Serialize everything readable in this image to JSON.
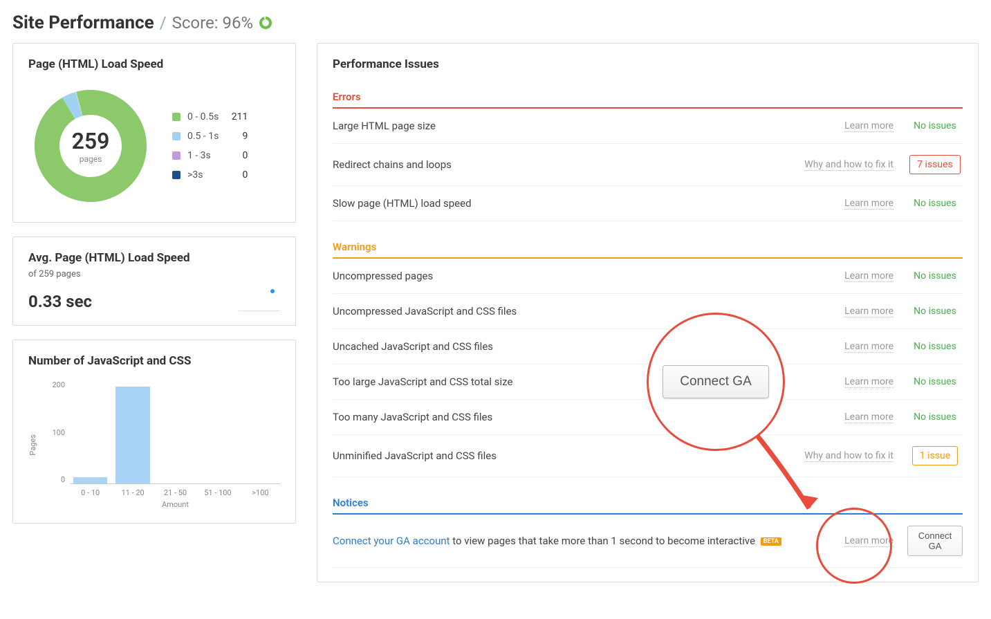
{
  "header": {
    "title": "Site Performance",
    "score_label": "Score: 96%",
    "score_ring_color": "#6bbf47"
  },
  "donut_card": {
    "title": "Page (HTML) Load Speed",
    "total": "259",
    "total_label": "pages",
    "legend": [
      {
        "label": "0 - 0.5s",
        "value": "211",
        "color": "#8bc96a"
      },
      {
        "label": "0.5 - 1s",
        "value": "9",
        "color": "#a2d2f2"
      },
      {
        "label": "1 - 3s",
        "value": "0",
        "color": "#c49bd8"
      },
      {
        "label": ">3s",
        "value": "0",
        "color": "#1a4f8b"
      }
    ]
  },
  "avg_card": {
    "title": "Avg. Page (HTML) Load Speed",
    "subtitle": "of 259 pages",
    "value": "0.33 sec"
  },
  "bar_card": {
    "title": "Number of JavaScript and CSS",
    "y_ticks": [
      "200",
      "100",
      "0"
    ],
    "y_label": "Pages",
    "x_label": "Amount",
    "bars": [
      {
        "label": "0 - 10",
        "h": 6
      },
      {
        "label": "11 - 20",
        "h": 94
      },
      {
        "label": "21 - 50",
        "h": 0
      },
      {
        "label": "51 - 100",
        "h": 0
      },
      {
        "label": ">100",
        "h": 0
      }
    ]
  },
  "issues": {
    "title": "Performance Issues",
    "errors": {
      "heading": "Errors",
      "rows": [
        {
          "name": "Large HTML page size",
          "hint": "Learn more",
          "status": "No issues",
          "kind": "ok"
        },
        {
          "name": "Redirect chains and loops",
          "hint": "Why and how to fix it",
          "status": "7 issues",
          "kind": "err"
        },
        {
          "name": "Slow page (HTML) load speed",
          "hint": "Learn more",
          "status": "No issues",
          "kind": "ok"
        }
      ]
    },
    "warnings": {
      "heading": "Warnings",
      "rows": [
        {
          "name": "Uncompressed pages",
          "hint": "Learn more",
          "status": "No issues",
          "kind": "ok"
        },
        {
          "name": "Uncompressed JavaScript and CSS files",
          "hint": "Learn more",
          "status": "No issues",
          "kind": "ok"
        },
        {
          "name": "Uncached JavaScript and CSS files",
          "hint": "Learn more",
          "status": "No issues",
          "kind": "ok"
        },
        {
          "name": "Too large JavaScript and CSS total size",
          "hint": "Learn more",
          "status": "No issues",
          "kind": "ok"
        },
        {
          "name": "Too many JavaScript and CSS files",
          "hint": "Learn more",
          "status": "No issues",
          "kind": "ok"
        },
        {
          "name": "Unminified JavaScript and CSS files",
          "hint": "Why and how to fix it",
          "status": "1 issue",
          "kind": "warn"
        }
      ]
    },
    "notices": {
      "heading": "Notices",
      "link_text": "Connect your GA account",
      "rest_text": " to view pages that take more than 1 second to become interactive ",
      "beta": "BETA",
      "hint": "Learn more",
      "button": "Connect GA"
    }
  },
  "callout_button": "Connect GA",
  "chart_data": [
    {
      "type": "pie",
      "title": "Page (HTML) Load Speed",
      "categories": [
        "0 - 0.5s",
        "0.5 - 1s",
        "1 - 3s",
        ">3s"
      ],
      "values": [
        211,
        9,
        0,
        0
      ],
      "total": 259,
      "center_label": "pages"
    },
    {
      "type": "bar",
      "title": "Number of JavaScript and CSS",
      "categories": [
        "0 - 10",
        "11 - 20",
        "21 - 50",
        "51 - 100",
        ">100"
      ],
      "values": [
        12,
        188,
        0,
        0,
        0
      ],
      "xlabel": "Amount",
      "ylabel": "Pages",
      "ylim": [
        0,
        200
      ]
    }
  ]
}
